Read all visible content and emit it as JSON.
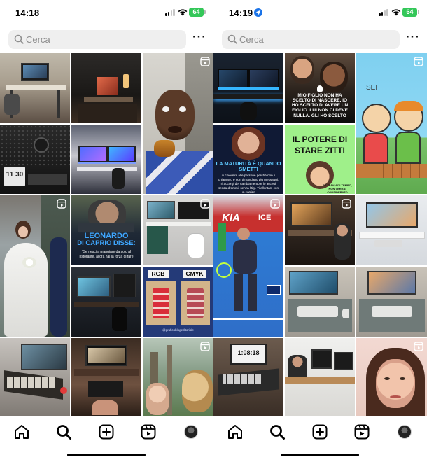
{
  "left_screen": {
    "status": {
      "time": "14:18",
      "battery": "64"
    },
    "search": {
      "placeholder": "Cerca",
      "more": "···"
    },
    "posts": {
      "clock_text": "11 30",
      "leonardo_line1": "LEONARDO",
      "leonardo_line2": "DI CAPRIO DISSE:",
      "leonardo_quote": "\"Se riesci a mangiare da solo al ristorante, allora hai la forza di fare",
      "rgb": "RGB",
      "cmyk": "CMYK",
      "meat_caption": "@graficoblogeditoriale"
    }
  },
  "right_screen": {
    "status": {
      "time": "14:19",
      "battery": "64"
    },
    "search": {
      "placeholder": "Cerca",
      "more": "···"
    },
    "posts": {
      "son_text": "MIO FIGLIO NON HA SCELTO DI NASCERE. IO HO SCELTO DI AVERE UN FIGLIO. LUI NON CI DEVE NULLA. GLI HO SCELTO",
      "sei": "SEI",
      "maturita_title": "LA MATURITÀ È QUANDO SMETTI",
      "maturita_text": "di chiedere alle persone perché non ti chiamano e non ti mandano più messaggi. Ti accorgi del cambiamento e lo accetti, senza drammi, senza litigi. Ti allontani con un sorriso.",
      "potere_line1": "IL POTERE DI",
      "potere_line2": "STARE ZITTI",
      "potere_caption": "SE TI AVANZI TEMPO, NON VERRAI CONSIDERATO",
      "kia": "KIA",
      "ice": "ICE",
      "clock_text": "1:08:18"
    }
  },
  "nav": {
    "icons": [
      "home-icon",
      "search-icon",
      "create-icon",
      "reels-icon",
      "profile-avatar"
    ]
  },
  "colors": {
    "search_bg": "#efefef",
    "placeholder": "#8e8e8e",
    "battery": "#34c759",
    "location": "#1a73e8"
  }
}
